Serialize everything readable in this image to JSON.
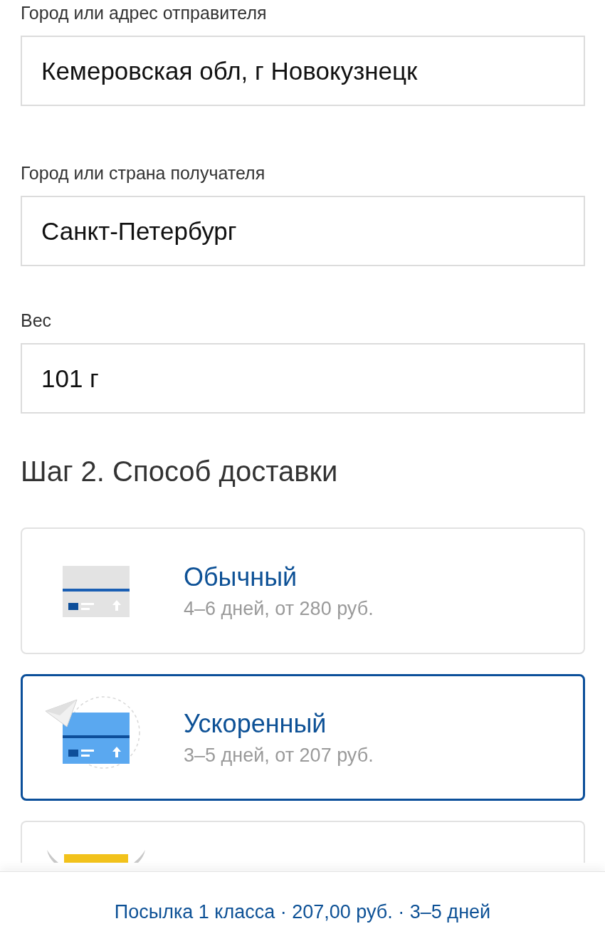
{
  "fields": [
    {
      "label": "Город или адрес отправителя",
      "value": "Кемеровская обл, г Новокузнецк"
    },
    {
      "label": "Город или страна получателя",
      "value": "Санкт-Петербург"
    },
    {
      "label": "Вес",
      "value": "101 г"
    }
  ],
  "step_heading": "Шаг 2. Способ доставки",
  "options": [
    {
      "kind": "standard",
      "title": "Обычный",
      "details": "4–6 дней, от 280 руб.",
      "selected": false
    },
    {
      "kind": "express",
      "title": "Ускоренный",
      "details": "3–5 дней, от 207 руб.",
      "selected": true
    },
    {
      "kind": "courier",
      "selected": false
    }
  ],
  "summary": "Посылка 1 класса · 207,00 руб. · 3–5 дней"
}
